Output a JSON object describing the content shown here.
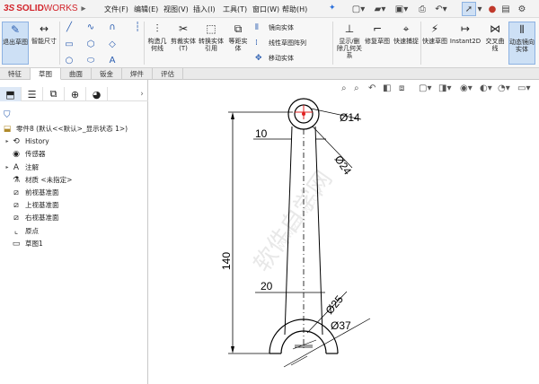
{
  "app": {
    "brand_ds": "3S",
    "brand_solid": "SOLID",
    "brand_works": "WORKS"
  },
  "menu": [
    "文件(F)",
    "编辑(E)",
    "视图(V)",
    "插入(I)",
    "工具(T)",
    "窗口(W)",
    "帮助(H)"
  ],
  "ribbon": {
    "exit_sketch": "退出草图",
    "smart_dim": "智能尺寸",
    "convert_entities_line": "构造几何线",
    "trim_entities": "剪裁实体(T)",
    "convert_entities": "转换实体引用",
    "offset_entities": "等距实体",
    "mirror_entities": "镜向实体",
    "linear_pattern": "线性草图阵列",
    "move_entities": "移动实体",
    "display_delete_relations": "显示/删除几何关系",
    "repair_sketch": "修复草图",
    "quick_snaps": "快速捕捉",
    "rapid_sketch": "快速草图",
    "instant2d": "Instant2D",
    "intersection_curve": "交叉曲线",
    "dynamic_mirror": "动态镜向实体"
  },
  "tabs": [
    {
      "label": "特征",
      "active": false
    },
    {
      "label": "草图",
      "active": true
    },
    {
      "label": "曲面",
      "active": false
    },
    {
      "label": "钣金",
      "active": false
    },
    {
      "label": "焊件",
      "active": false
    },
    {
      "label": "评估",
      "active": false
    }
  ],
  "tree": {
    "root": "零件8 (默认<<默认>_显示状态 1>)",
    "items": [
      {
        "label": "History",
        "icon": "history-icon",
        "expandable": true
      },
      {
        "label": "传感器",
        "icon": "sensor-icon",
        "expandable": false
      },
      {
        "label": "注解",
        "icon": "annotation-icon",
        "expandable": true
      },
      {
        "label": "材质 <未指定>",
        "icon": "material-icon",
        "expandable": false
      },
      {
        "label": "前视基准面",
        "icon": "plane-icon",
        "expandable": false
      },
      {
        "label": "上视基准面",
        "icon": "plane-icon",
        "expandable": false
      },
      {
        "label": "右视基准面",
        "icon": "plane-icon",
        "expandable": false
      },
      {
        "label": "原点",
        "icon": "origin-icon",
        "expandable": false
      },
      {
        "label": "草图1",
        "icon": "sketch-icon",
        "expandable": false
      }
    ]
  },
  "drawing": {
    "dim_d14": "Ø14",
    "dim_10": "10",
    "dim_d24": "Ø24",
    "dim_140": "140",
    "dim_20": "20",
    "dim_d25": "Ø25",
    "dim_d37": "Ø37",
    "watermark": "软件自学网",
    "watermark_url": "WWW.RJZXW.COM"
  },
  "colors": {
    "accent": "#2a6fdb",
    "brand": "#d2232a",
    "sketch_line": "#000000",
    "highlight": "#e02020"
  }
}
